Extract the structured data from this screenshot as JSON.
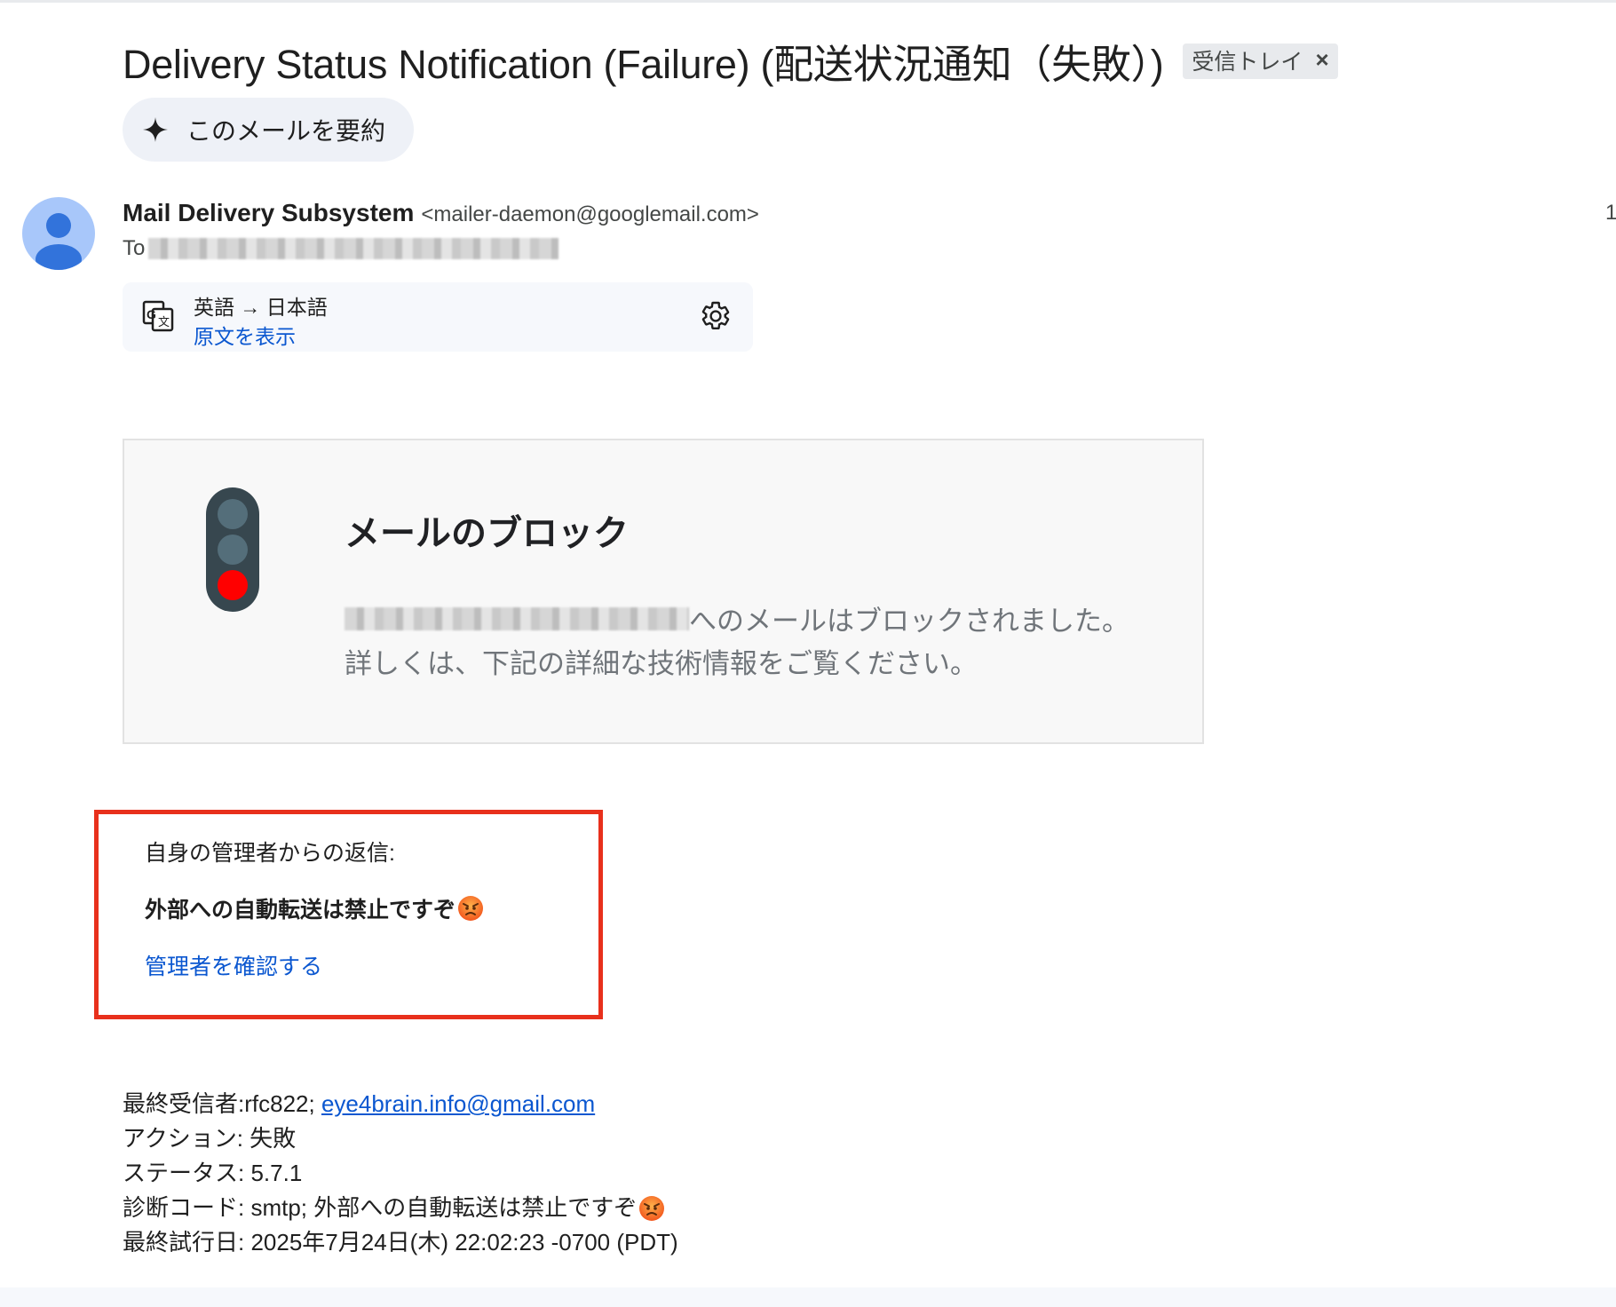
{
  "email": {
    "subject": "Delivery Status Notification (Failure) (配送状況通知（失敗）)",
    "label_chip": "受信トレイ",
    "label_chip_close": "×",
    "summarize_label": "このメールを要約",
    "sender_name": "Mail Delivery Subsystem",
    "sender_email": "<mailer-daemon@googlemail.com>",
    "date_partial": "1",
    "to_label": "To"
  },
  "translation": {
    "languages": "英語 → 日本語",
    "show_original": "原文を表示"
  },
  "block_card": {
    "title": "メールのブロック",
    "message_line1": "へのメールはブロックされました。",
    "message_line2": "詳しくは、下記の詳細な技術情報をご覧ください。"
  },
  "admin_box": {
    "reply_label": "自身の管理者からの返信:",
    "message": "外部への自動転送は禁止ですぞ",
    "link": "管理者を確認する"
  },
  "details": {
    "final_recipient_label": "最終受信者: ",
    "final_recipient_prefix": "rfc822; ",
    "final_recipient_email": "eye4brain.info@gmail.com",
    "action": "アクション: 失敗",
    "status": "ステータス: 5.7.1",
    "diagnostic": "診断コード: smtp; 外部への自動転送は禁止ですぞ",
    "last_attempt": "最終試行日: 2025年7月24日(木) 22:02:23 -0700 (PDT)"
  },
  "icons": {
    "sparkle": "sparkle-icon",
    "avatar": "person-avatar-icon",
    "translate": "translate-icon",
    "settings": "gear-icon",
    "traffic_light": "traffic-light-icon",
    "angry_emoji": "angry-face-emoji"
  },
  "colors": {
    "link": "#0b57d0",
    "highlight_border": "#e8301c",
    "stop_light": "#ff0000"
  }
}
